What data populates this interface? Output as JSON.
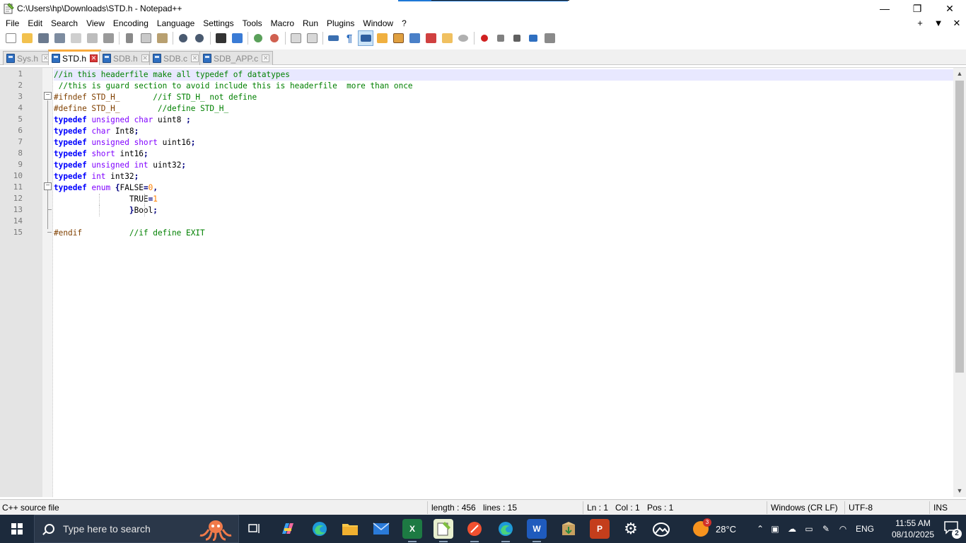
{
  "window": {
    "title": "C:\\Users\\hp\\Downloads\\STD.h - Notepad++",
    "minimize": "—",
    "restore": "❐",
    "close": "✕"
  },
  "menu": {
    "items": [
      "File",
      "Edit",
      "Search",
      "View",
      "Encoding",
      "Language",
      "Settings",
      "Tools",
      "Macro",
      "Run",
      "Plugins",
      "Window",
      "?"
    ],
    "right": [
      "+",
      "▼",
      "✕"
    ]
  },
  "tabs": [
    {
      "label": "Sys.h",
      "active": false
    },
    {
      "label": "STD.h",
      "active": true
    },
    {
      "label": "SDB.h",
      "active": false
    },
    {
      "label": "SDB.c",
      "active": false
    },
    {
      "label": "SDB_APP.c",
      "active": false
    }
  ],
  "tab_close": "✕",
  "editor": {
    "line_numbers": [
      "1",
      "2",
      "3",
      "4",
      "5",
      "6",
      "7",
      "8",
      "9",
      "10",
      "11",
      "12",
      "13",
      "14",
      "15"
    ],
    "fold_minus": "−",
    "lines": [
      {
        "tokens": [
          [
            "cm",
            "//in this headerfile make all typedef of datatypes"
          ]
        ]
      },
      {
        "tokens": [
          [
            "tx",
            " "
          ],
          [
            "cm",
            "//this is guard section to avoid include this is headerfile  more than once"
          ]
        ]
      },
      {
        "tokens": [
          [
            "pp",
            "#ifndef STD_H_       "
          ],
          [
            "cm",
            "//if STD_H_ not define"
          ]
        ]
      },
      {
        "tokens": [
          [
            "pp",
            "#define STD_H_        "
          ],
          [
            "cm",
            "//define STD_H_"
          ]
        ]
      },
      {
        "tokens": [
          [
            "kw",
            "typedef"
          ],
          [
            "tx",
            " "
          ],
          [
            "ty",
            "unsigned"
          ],
          [
            "tx",
            " "
          ],
          [
            "ty",
            "char"
          ],
          [
            "tx",
            " uint8 "
          ],
          [
            "op",
            ";"
          ]
        ]
      },
      {
        "tokens": [
          [
            "kw",
            "typedef"
          ],
          [
            "tx",
            " "
          ],
          [
            "ty",
            "char"
          ],
          [
            "tx",
            " Int8"
          ],
          [
            "op",
            ";"
          ]
        ]
      },
      {
        "tokens": [
          [
            "kw",
            "typedef"
          ],
          [
            "tx",
            " "
          ],
          [
            "ty",
            "unsigned"
          ],
          [
            "tx",
            " "
          ],
          [
            "ty",
            "short"
          ],
          [
            "tx",
            " uint16"
          ],
          [
            "op",
            ";"
          ]
        ]
      },
      {
        "tokens": [
          [
            "kw",
            "typedef"
          ],
          [
            "tx",
            " "
          ],
          [
            "ty",
            "short"
          ],
          [
            "tx",
            " int16"
          ],
          [
            "op",
            ";"
          ]
        ]
      },
      {
        "tokens": [
          [
            "kw",
            "typedef"
          ],
          [
            "tx",
            " "
          ],
          [
            "ty",
            "unsigned"
          ],
          [
            "tx",
            " "
          ],
          [
            "ty",
            "int"
          ],
          [
            "tx",
            " uint32"
          ],
          [
            "op",
            ";"
          ]
        ]
      },
      {
        "tokens": [
          [
            "kw",
            "typedef"
          ],
          [
            "tx",
            " "
          ],
          [
            "ty",
            "int"
          ],
          [
            "tx",
            " int32"
          ],
          [
            "op",
            ";"
          ]
        ]
      },
      {
        "tokens": [
          [
            "kw",
            "typedef"
          ],
          [
            "tx",
            " "
          ],
          [
            "ty",
            "enum"
          ],
          [
            "tx",
            " "
          ],
          [
            "op",
            "{"
          ],
          [
            "tx",
            "FALSE"
          ],
          [
            "op",
            "="
          ],
          [
            "nm",
            "0"
          ],
          [
            "op",
            ","
          ]
        ]
      },
      {
        "tokens": [
          [
            "tx",
            "                TRUE"
          ],
          [
            "op",
            "="
          ],
          [
            "nm",
            "1"
          ]
        ]
      },
      {
        "tokens": [
          [
            "tx",
            "                "
          ],
          [
            "op",
            "}"
          ],
          [
            "tx",
            "Bool"
          ],
          [
            "op",
            ";"
          ]
        ]
      },
      {
        "tokens": [
          [
            "tx",
            ""
          ]
        ]
      },
      {
        "tokens": [
          [
            "pp",
            "#endif          "
          ],
          [
            "cm",
            "//if define EXIT"
          ]
        ]
      }
    ],
    "scroll_up": "▲",
    "scroll_down": "▼"
  },
  "status": {
    "file_type": "C++ source file",
    "length": "length : 456",
    "lines": "lines : 15",
    "ln": "Ln : 1",
    "col": "Col : 1",
    "pos": "Pos : 1",
    "eol": "Windows (CR LF)",
    "encoding": "UTF-8",
    "mode": "INS"
  },
  "taskbar": {
    "search_placeholder": "Type here to search",
    "weather_temp": "28°C",
    "weather_badge": "3",
    "language": "ENG",
    "time": "11:55 AM",
    "date": "08/10/2025",
    "notification_count": "2",
    "excel_letter": "X",
    "word_letter": "W",
    "ppt_letter": "P"
  },
  "colors": {
    "taskbar_bg": "#1c2a3c",
    "active_tab_accent": "#faaa3c",
    "comment": "#008000",
    "keyword": "#0000ff",
    "type": "#8000ff",
    "preprocessor": "#804000",
    "number": "#ff8000"
  }
}
